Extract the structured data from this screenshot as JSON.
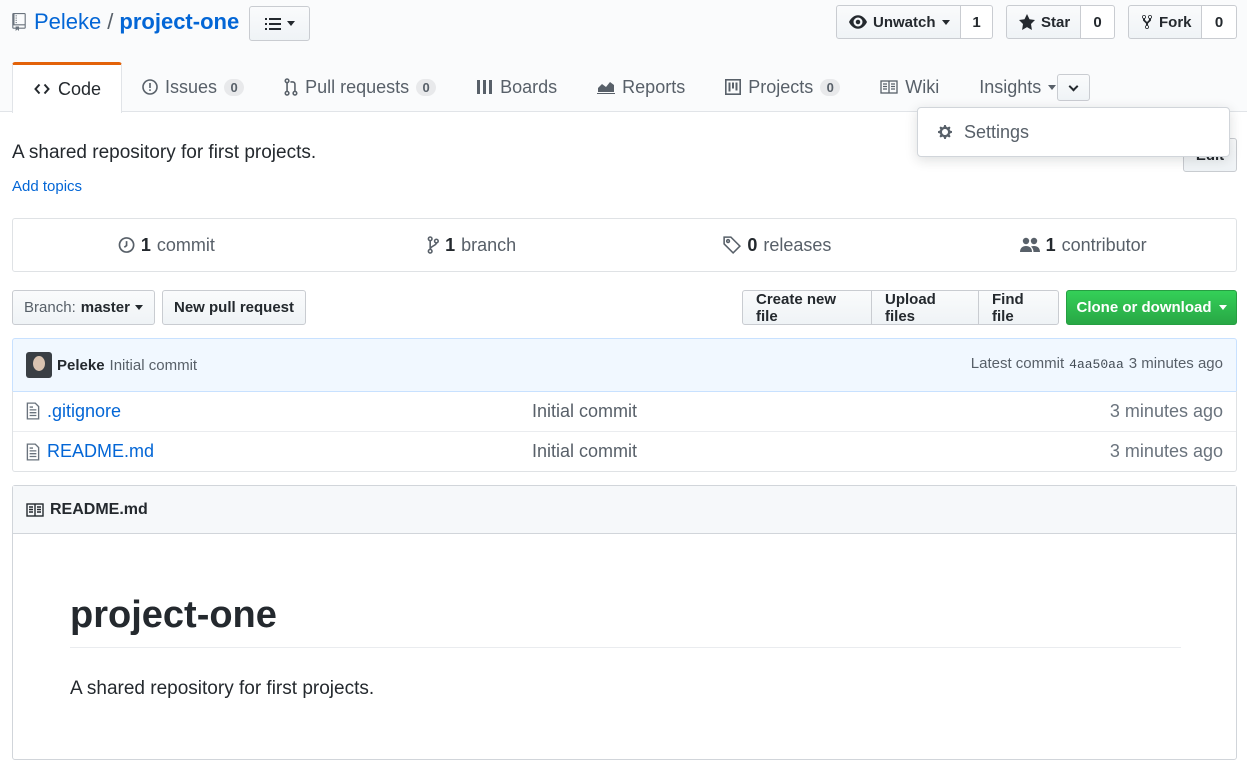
{
  "repo": {
    "owner": "Peleke",
    "separator": "/",
    "name": "project-one"
  },
  "actions": {
    "watch": {
      "label": "Unwatch",
      "count": "1"
    },
    "star": {
      "label": "Star",
      "count": "0"
    },
    "fork": {
      "label": "Fork",
      "count": "0"
    }
  },
  "tabs": [
    {
      "label": "Code",
      "icon": "code-icon",
      "selected": true
    },
    {
      "label": "Issues",
      "icon": "issue-icon",
      "counter": "0"
    },
    {
      "label": "Pull requests",
      "icon": "pull-request-icon",
      "counter": "0"
    },
    {
      "label": "Boards",
      "icon": "boards-icon"
    },
    {
      "label": "Reports",
      "icon": "graph-icon"
    },
    {
      "label": "Projects",
      "icon": "project-icon",
      "counter": "0"
    },
    {
      "label": "Wiki",
      "icon": "book-icon"
    },
    {
      "label": "Insights",
      "icon": "chevron-down-icon"
    }
  ],
  "dropdown": {
    "items": [
      {
        "label": "Settings",
        "icon": "gear-icon"
      }
    ]
  },
  "about": {
    "description": "A shared repository for first projects.",
    "add_topics": "Add topics",
    "edit_label": "Edit"
  },
  "summary": {
    "commits": {
      "count": "1",
      "label": "commit"
    },
    "branches": {
      "count": "1",
      "label": "branch"
    },
    "releases": {
      "count": "0",
      "label": "releases"
    },
    "contributors": {
      "count": "1",
      "label": "contributor"
    }
  },
  "file_nav": {
    "branch_label": "Branch:",
    "branch_value": "master",
    "new_pr": "New pull request",
    "create_file": "Create new file",
    "upload_files": "Upload files",
    "find_file": "Find file",
    "clone": "Clone or download"
  },
  "latest_commit": {
    "author": "Peleke",
    "message": "Initial commit",
    "prefix": "Latest commit",
    "sha": "4aa50aa",
    "age": "3 minutes ago"
  },
  "files": [
    {
      "name": ".gitignore",
      "message": "Initial commit",
      "age": "3 minutes ago"
    },
    {
      "name": "README.md",
      "message": "Initial commit",
      "age": "3 minutes ago"
    }
  ],
  "readme": {
    "filename": "README.md",
    "heading": "project-one",
    "body": "A shared repository for first projects."
  },
  "colors": {
    "link": "#0366d6",
    "selected_tab_accent": "#e36209",
    "clone_button": "#28a745"
  }
}
